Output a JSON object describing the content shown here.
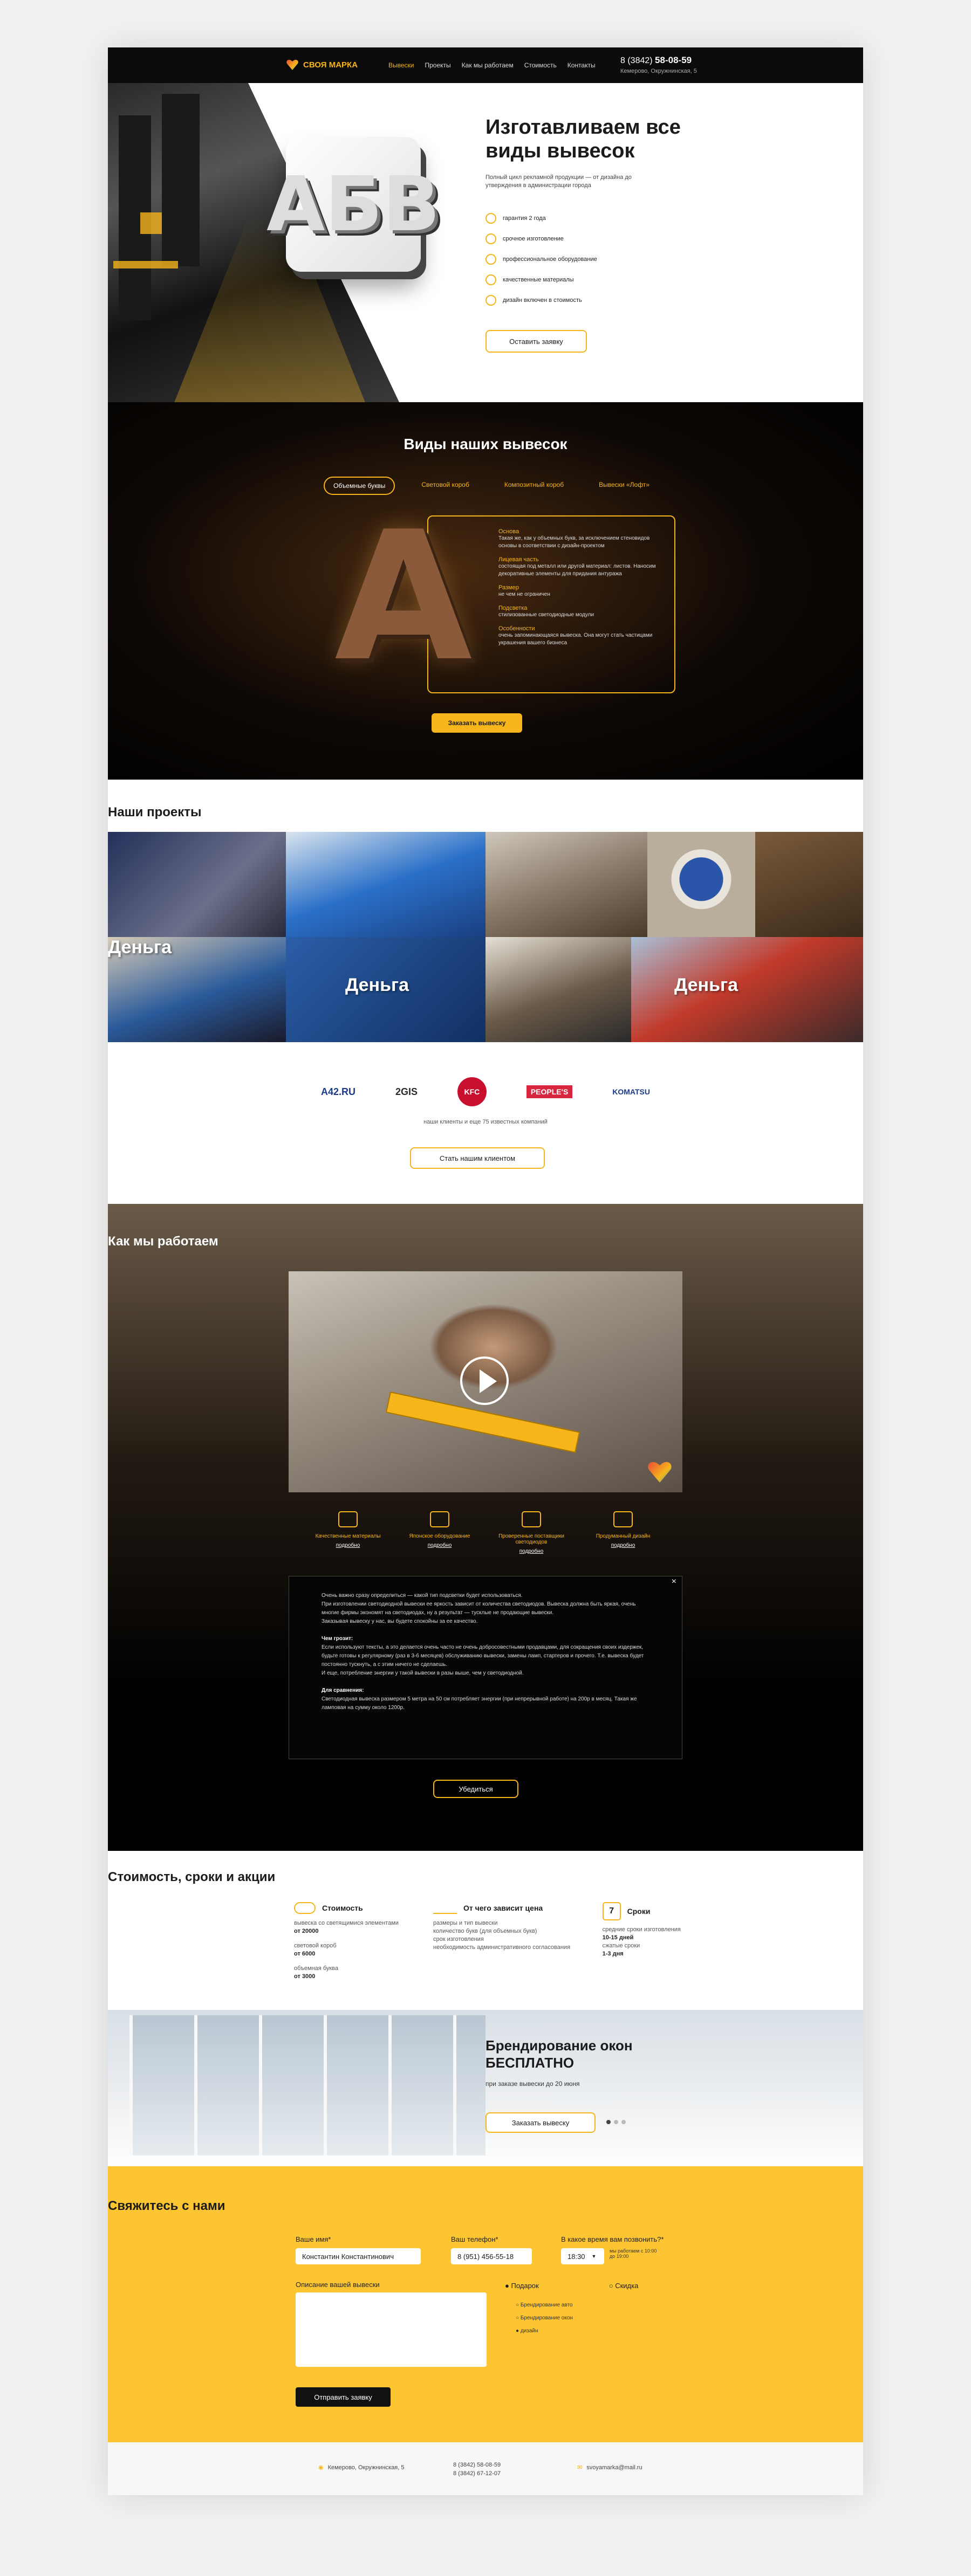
{
  "header": {
    "logo": "СВОЯ МАРКА",
    "nav": [
      "Вывески",
      "Проекты",
      "Как мы работаем",
      "Стоимость",
      "Контакты"
    ],
    "phone_prefix": "8 (3842)",
    "phone": "58-08-59",
    "address": "Кемерово, Окружнинская, 5"
  },
  "hero": {
    "sign_letters": "АБВ",
    "title": "Изготавливаем все виды вывесок",
    "lead": "Полный цикл рекламной продукции — от дизайна до утверждения в администрации города",
    "features": [
      "гарантия 2 года",
      "срочное изготовление",
      "профессиональное оборудование",
      "качественные материалы",
      "дизайн включен в стоимость"
    ],
    "cta": "Оставить заявку"
  },
  "types": {
    "title": "Виды наших вывесок",
    "tabs": [
      "Объемные буквы",
      "Световой короб",
      "Композитный короб",
      "Вывески «Лофт»"
    ],
    "letter": "A",
    "info": [
      {
        "t": "Основа",
        "d": "Такая же, как у объемных букв, за исключением стеновидов основы в соответствии с дизайн-проектом"
      },
      {
        "t": "Лицевая часть",
        "d": "состоящая под металл или другой материал: листов. Наносим декоративные элементы для придания антуража"
      },
      {
        "t": "Размер",
        "d": "не чем не ограничен"
      },
      {
        "t": "Подсветка",
        "d": "стилизованные светодиодные модули"
      },
      {
        "t": "Особенности",
        "d": "очень запоминающаяся вывеска. Она могут стать частицами украшения вашего бизнеса"
      }
    ],
    "cta": "Заказать вывеску"
  },
  "projects": {
    "title": "Наши проекты",
    "tiles": [
      "",
      "",
      "",
      "",
      "",
      "Деньга",
      "",
      "Деньга"
    ],
    "clients": [
      "А42.RU",
      "2GIS",
      "KFC",
      "PEOPLE'S",
      "KOMATSU"
    ],
    "note": "наши клиенты и еще 75 известных компаний",
    "cta": "Стать нашим клиентом"
  },
  "how": {
    "title": "Как мы работаем",
    "steps": [
      {
        "t": "Качественные материалы",
        "m": "подробно"
      },
      {
        "t": "Японское оборудование",
        "m": "подробно"
      },
      {
        "t": "Проверенные поставщики светодиодов",
        "m": "подробно"
      },
      {
        "t": "Продуманный дизайн",
        "m": "подробно"
      }
    ],
    "modal": {
      "p1": "Очень важно сразу определиться — какой тип подсветки будет использоваться.",
      "p2": "При изготовлении светодиодной вывески ее яркость зависит от количества светодиодов. Вывеска должна быть яркая, очень многие фирмы экономят на светодиодах, ну а результат — тусклые не продающие вывески.",
      "p3": "Заказывая вывеску у нас, вы будете спокойны за ее качество.",
      "h2": "Чем грозит:",
      "p4": "Если используют тексты, а это делается очень часто не очень добросовестными продавцами, для сокращения своих издержек, будьте готовы к регулярному (раз в 3-6 месяцев) обслуживанию вывески, замены ламп, стартеров и прочего. Т.е. вывеска будет постоянно тускнуть, а с этим ничего не сделаешь.",
      "p5": "И еще, потребление энергии у такой вывески в разы выше, чем у светодиодной.",
      "h3": "Для сравнения:",
      "p6": "Светодиодная вывеска размером 5 метра на 50 см потребляет энергии (при непрерывной работе) на 200р в месяц. Такая же ламповая на сумму около 1200р.",
      "close": "×"
    },
    "cta": "Убедиться"
  },
  "pricing": {
    "title": "Стоимость, сроки и акции",
    "cost": {
      "h": "Стоимость",
      "items": [
        "вывеска со светящимися элементами",
        "от 20000",
        "световой короб",
        "от 6000",
        "объемная буква",
        "от 3000"
      ]
    },
    "depends": {
      "h": "От чего зависит цена",
      "items": [
        "размеры и тип вывески",
        "количество букв (для объемных букв)",
        "срок изготовления",
        "необходимость административного согласования"
      ]
    },
    "terms": {
      "h": "Сроки",
      "icon": "7",
      "items": [
        "средние сроки изготовления",
        "10-15 дней",
        "сжатые сроки",
        "1-3 дня"
      ]
    }
  },
  "promo": {
    "title": "Брендирование окон БЕСПЛАТНО",
    "sub": "при заказе вывески до 20 июня",
    "cta": "Заказать вывеску"
  },
  "contact": {
    "title": "Свяжитесь с нами",
    "name_label": "Ваше имя*",
    "name": "Константин Константинович",
    "phone_label": "Ваш телефон*",
    "phone": "8 (951) 456-55-18",
    "time_label": "В какое время вам позвонить?*",
    "time": "18:30",
    "time_note": "мы работаем с 10:00 до 19:00",
    "desc_label": "Описание вашей вывески",
    "radio": [
      "Подарок",
      "Скидка"
    ],
    "options": [
      "Брендирование авто",
      "Брендирование окон",
      "дизайн"
    ],
    "submit": "Отправить заявку"
  },
  "footer": {
    "address": "Кемерово, Окружнинская, 5",
    "phones": [
      "8 (3842) 58-08-59",
      "8 (3842) 67-12-07"
    ],
    "email": "svoyamarka@mail.ru"
  }
}
